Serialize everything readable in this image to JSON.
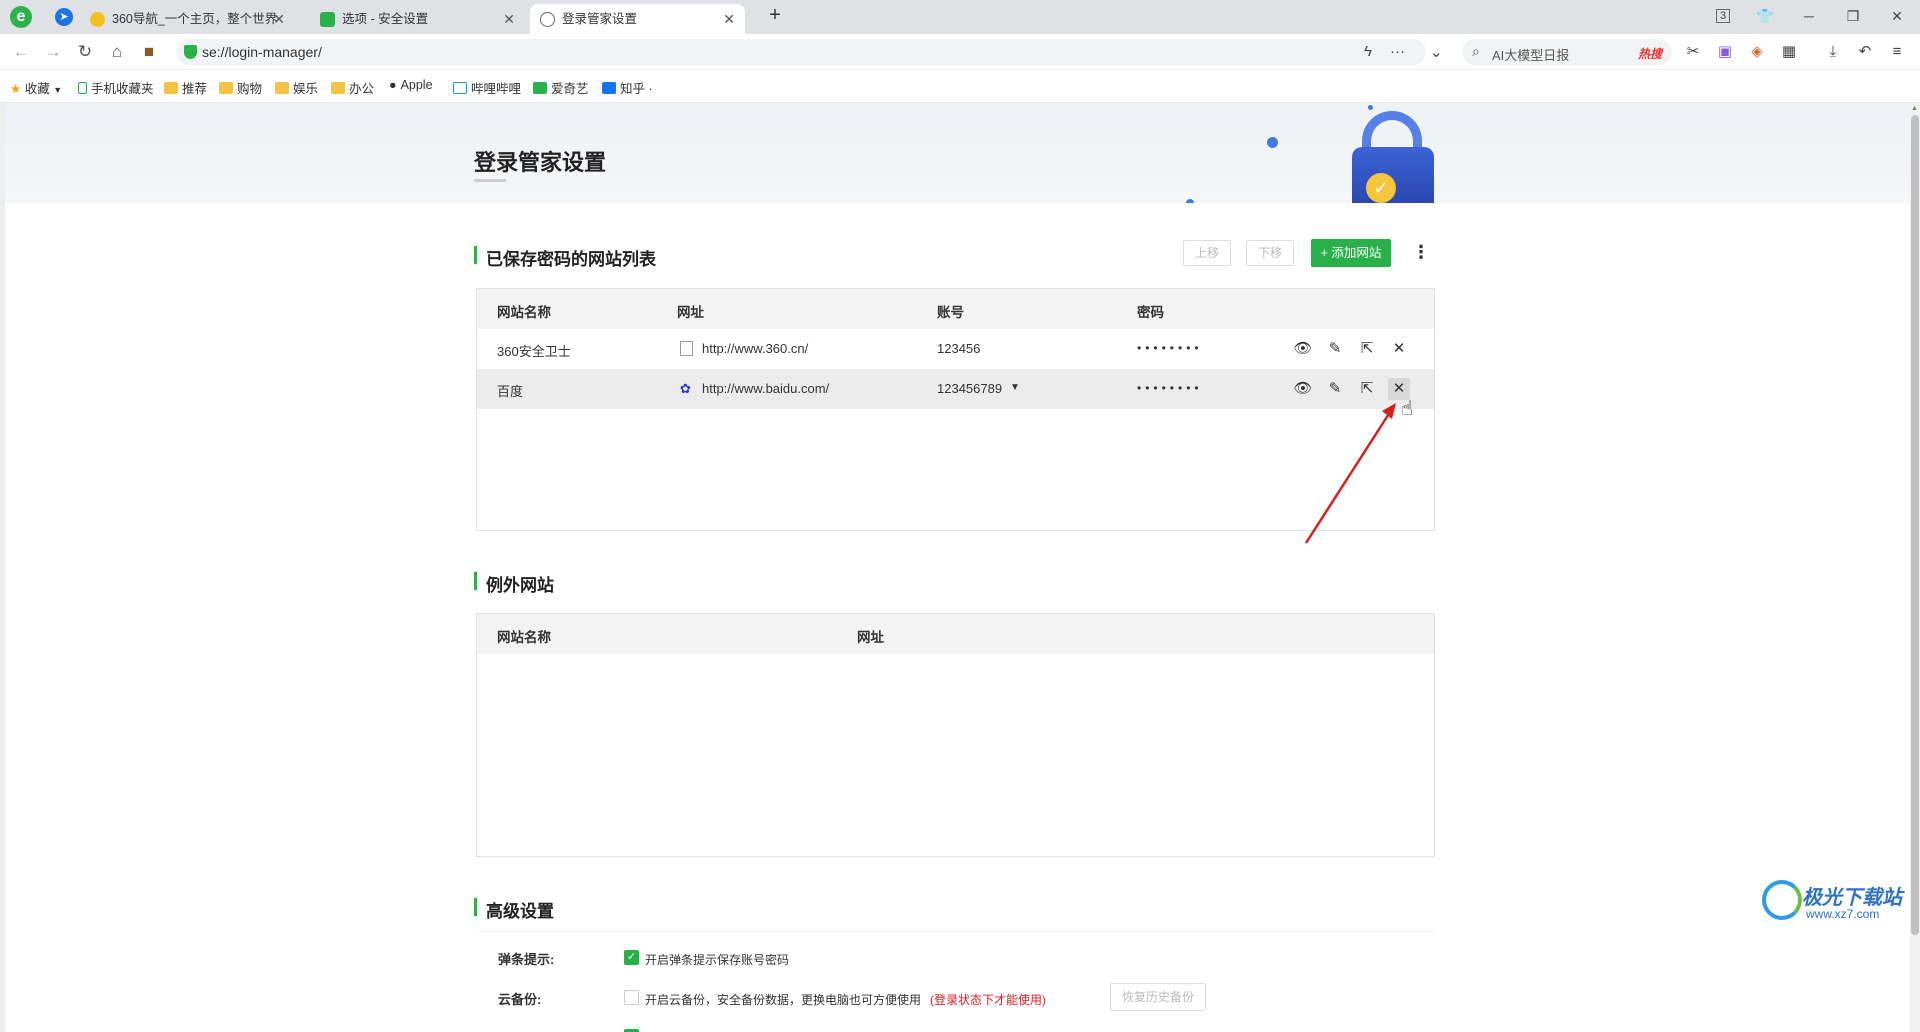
{
  "browser": {
    "tabs": [
      {
        "label": "360导航_一个主页，整个世界",
        "icon": "360-nav-icon"
      },
      {
        "label": "选项 - 安全设置",
        "icon": "options-icon"
      },
      {
        "label": "登录管家设置",
        "icon": "globe-icon",
        "active": true
      }
    ],
    "new_tab": "+",
    "tab_count": "3",
    "address": "se://login-manager/",
    "search_placeholder": "AI大模型日报",
    "search_hot": "热搜",
    "bookmarks": [
      {
        "label": "收藏",
        "icon": "star-icon"
      },
      {
        "label": "手机收藏夹",
        "icon": "phone-icon"
      },
      {
        "label": "推荐",
        "icon": "folder-icon"
      },
      {
        "label": "购物",
        "icon": "folder-icon"
      },
      {
        "label": "娱乐",
        "icon": "folder-icon"
      },
      {
        "label": "办公",
        "icon": "folder-icon"
      },
      {
        "label": "Apple",
        "icon": "apple-icon"
      },
      {
        "label": "哔哩哔哩",
        "icon": "bilibili-icon"
      },
      {
        "label": "爱奇艺",
        "icon": "iqiyi-icon"
      },
      {
        "label": "知乎",
        "icon": "zhihu-icon"
      }
    ],
    "bookmarks_more": "·"
  },
  "page": {
    "title": "登录管家设置",
    "saved_section": {
      "title": "已保存密码的网站列表",
      "move_up": "上移",
      "move_down": "下移",
      "add_site": "+ 添加网站",
      "columns": [
        "网站名称",
        "网址",
        "账号",
        "密码"
      ],
      "rows": [
        {
          "name": "360安全卫士",
          "url": "http://www.360.cn/",
          "account": "123456",
          "password": "••••••••",
          "favicon": "page-icon"
        },
        {
          "name": "百度",
          "url": "http://www.baidu.com/",
          "account": "123456789",
          "password": "••••••••",
          "favicon": "baidu-icon",
          "has_dropdown": true,
          "highlighted": true
        }
      ]
    },
    "exception_section": {
      "title": "例外网站",
      "columns": [
        "网站名称",
        "网址"
      ]
    },
    "advanced_section": {
      "title": "高级设置",
      "popup_label": "弹条提示:",
      "popup_text": "开启弹条提示保存账号密码",
      "popup_checked": true,
      "cloud_label": "云备份:",
      "cloud_text": "开启云备份，安全备份数据，更换电脑也可方便使用",
      "cloud_note": "(登录状态下才能使用)",
      "cloud_checked": false,
      "restore_button": "恢复历史备份"
    }
  },
  "watermark": {
    "text": "极光下载站",
    "url": "www.xz7.com"
  },
  "colors": {
    "accent": "#27b148",
    "arrow": "#d42020",
    "warning_text": "#e02020"
  }
}
